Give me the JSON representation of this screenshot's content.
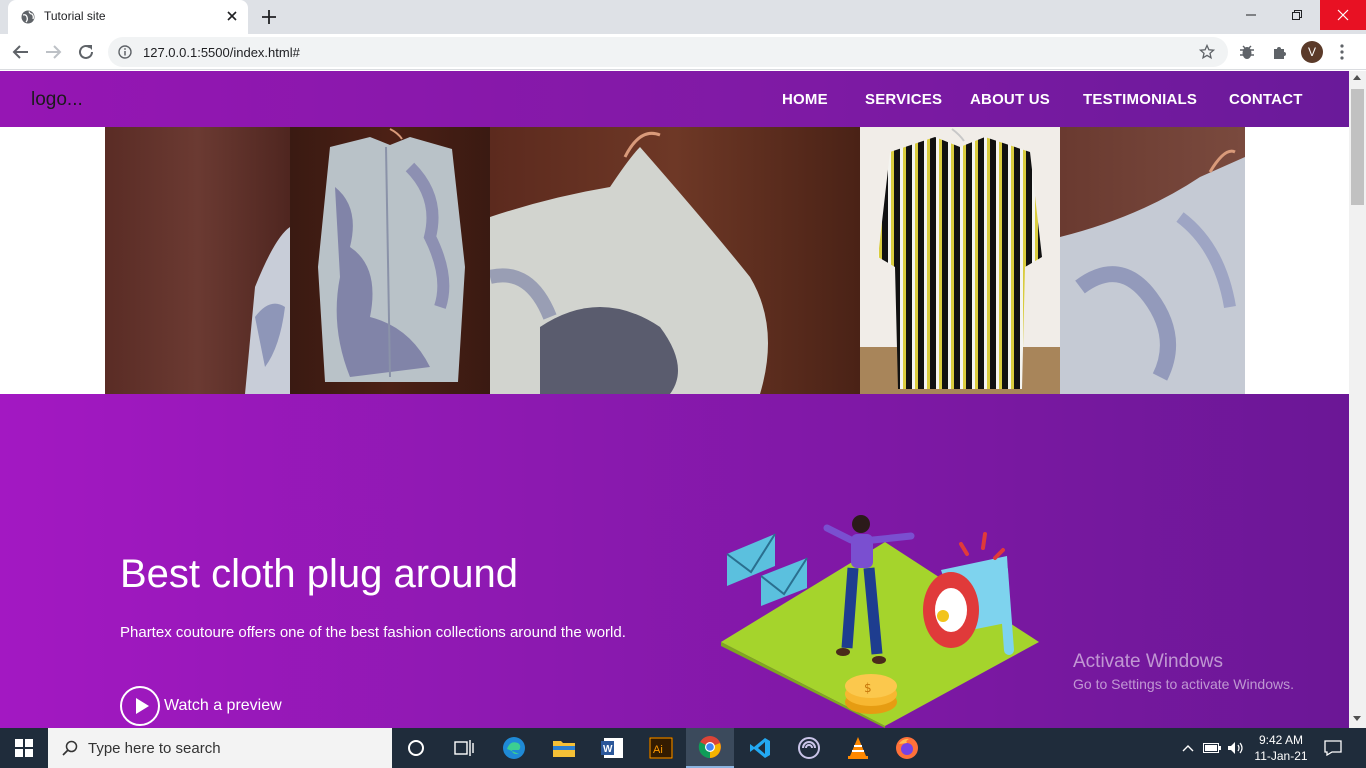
{
  "browser": {
    "tab_title": "Tutorial site",
    "url": "127.0.0.1:5500/index.html#",
    "profile_initial": "V"
  },
  "site": {
    "logo": "logo...",
    "nav": [
      "HOME",
      "SERVICES",
      "ABOUT US",
      "TESTIMONIALS",
      "CONTACT"
    ],
    "hero": {
      "title": "Best cloth plug around",
      "text": "Phartex coutoure offers one of the best fashion collections around the world.",
      "preview_label": "Watch a preview"
    },
    "colors": {
      "accent": "#9616b4",
      "accent_dark": "#6a1a9a",
      "illustration_green": "#a5d42c"
    }
  },
  "watermark": {
    "line1": "Activate Windows",
    "line2": "Go to Settings to activate Windows."
  },
  "taskbar": {
    "search_placeholder": "Type here to search",
    "time": "9:42 AM",
    "date": "11-Jan-21",
    "apps": [
      "cortana-icon",
      "task-view-icon",
      "edge-icon",
      "file-explorer-icon",
      "word-icon",
      "illustrator-icon",
      "chrome-icon",
      "vscode-icon",
      "app-icon",
      "vlc-icon",
      "firefox-icon"
    ]
  }
}
